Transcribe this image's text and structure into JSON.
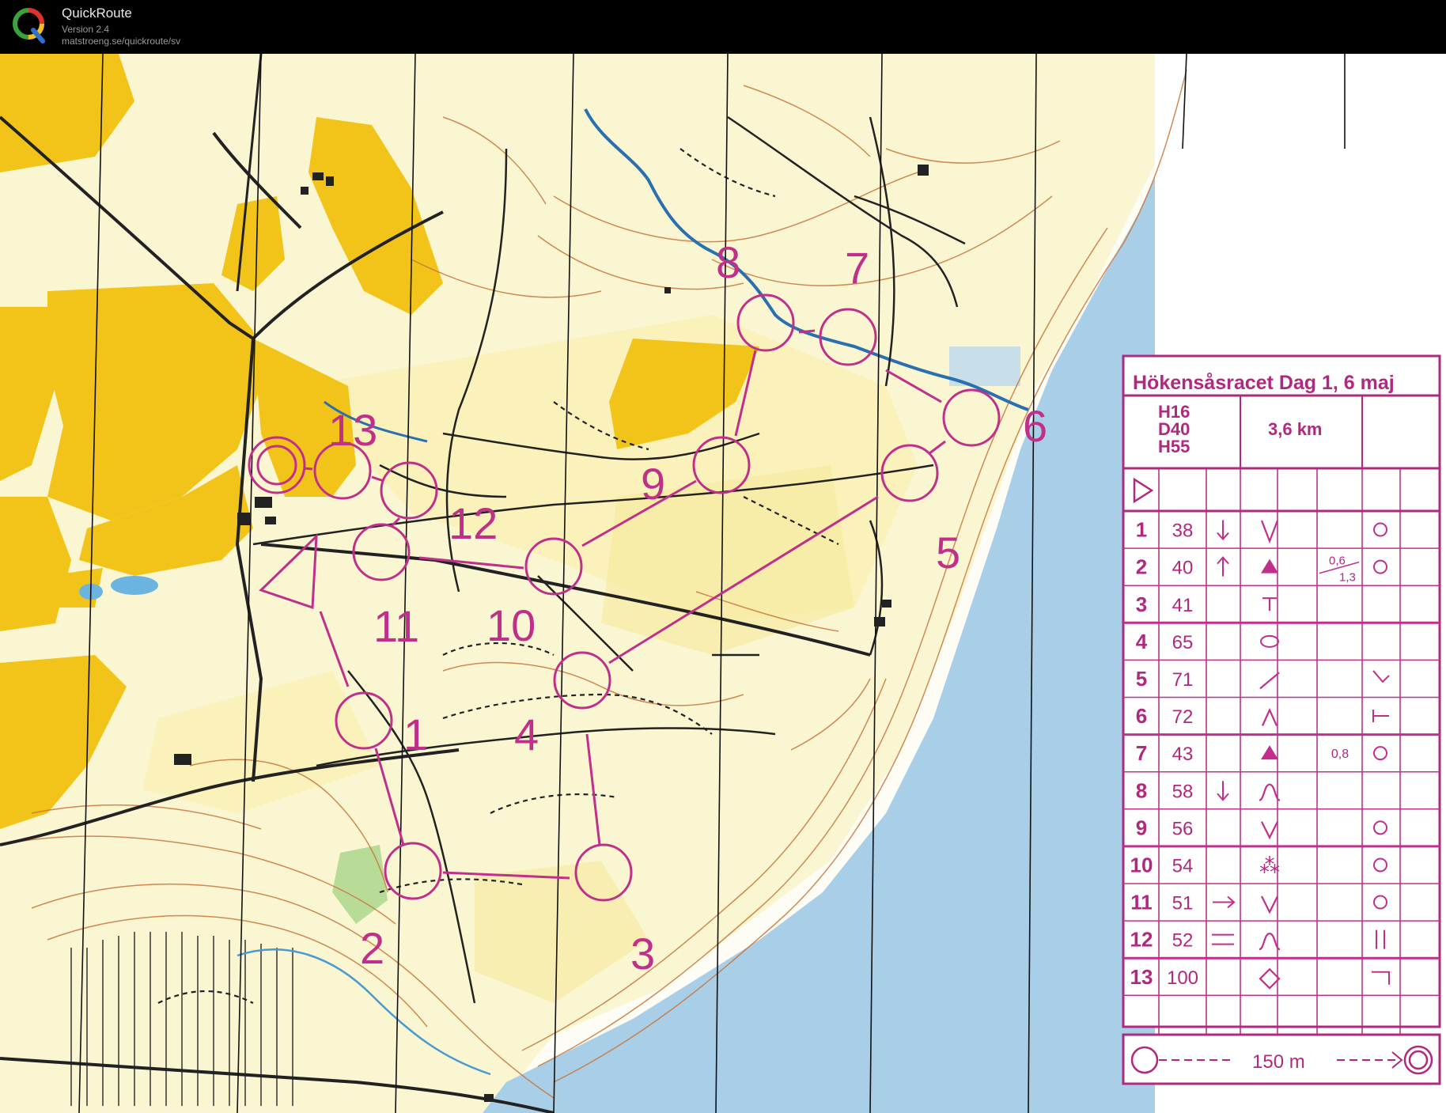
{
  "app": {
    "name": "QuickRoute",
    "version": "Version 2.4",
    "url": "matstroeng.se/quickroute/sv"
  },
  "course": {
    "title": "Hökensåsracet Dag 1, 6 maj",
    "classes": [
      "H16",
      "D40",
      "H55"
    ],
    "length": "3,6 km",
    "scale_distance": "150 m",
    "controls": [
      {
        "num": "1",
        "code": "38"
      },
      {
        "num": "2",
        "code": "40",
        "leg_distance": [
          "0,6",
          "1,3"
        ]
      },
      {
        "num": "3",
        "code": "41"
      },
      {
        "num": "4",
        "code": "65"
      },
      {
        "num": "5",
        "code": "71"
      },
      {
        "num": "6",
        "code": "72"
      },
      {
        "num": "7",
        "code": "43",
        "leg_distance": [
          "0,8"
        ]
      },
      {
        "num": "8",
        "code": "58"
      },
      {
        "num": "9",
        "code": "56"
      },
      {
        "num": "10",
        "code": "54"
      },
      {
        "num": "11",
        "code": "51"
      },
      {
        "num": "12",
        "code": "52"
      },
      {
        "num": "13",
        "code": "100"
      }
    ]
  },
  "colors": {
    "course": "#c0308a",
    "open_land": "#f2c41a",
    "rough_open": "#fbf3b8",
    "water": "#a9cfe8",
    "contour": "#c8763a",
    "path": "#222222"
  }
}
